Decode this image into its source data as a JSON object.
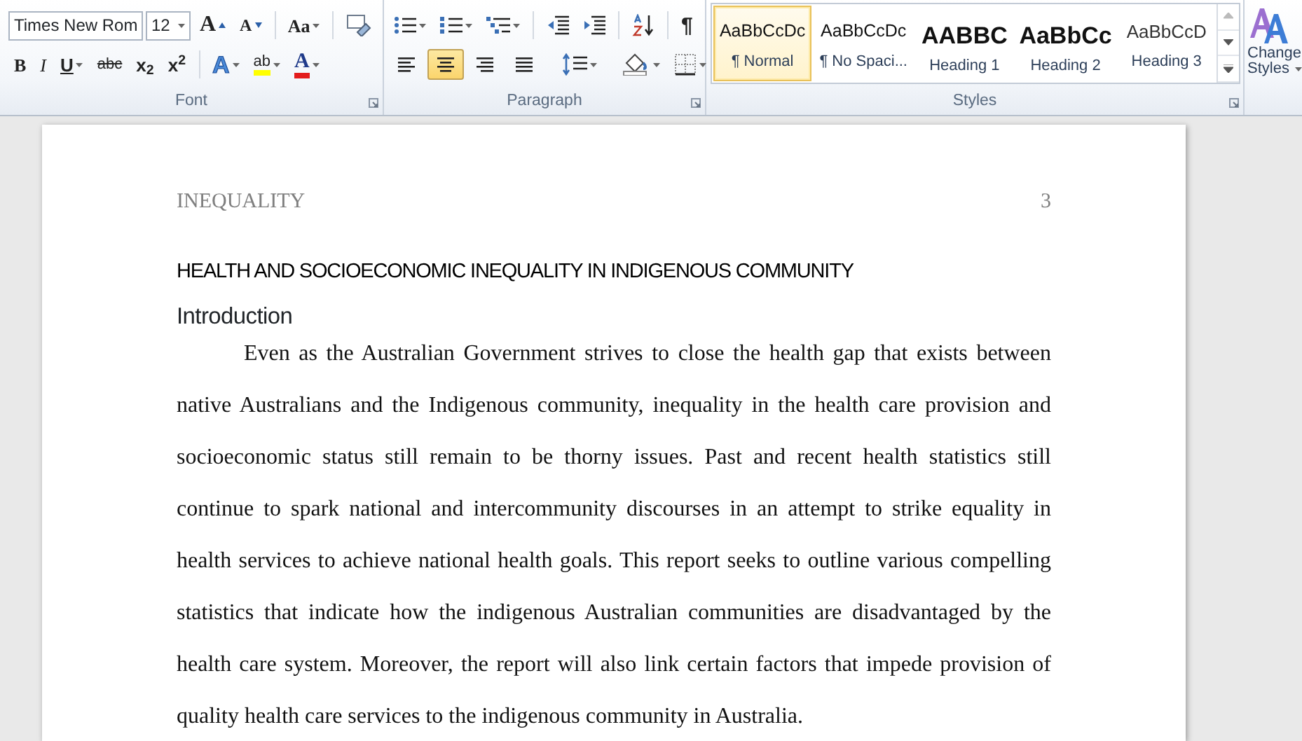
{
  "ribbon": {
    "font_group": {
      "title": "Font",
      "font_name": "Times New Rom",
      "font_size": "12",
      "row1": [
        {
          "kind": "grow",
          "glyph": "A"
        },
        {
          "kind": "shrink",
          "glyph": "A"
        },
        {
          "kind": "case",
          "glyph": "Aa"
        },
        {
          "kind": "clear"
        }
      ],
      "row2": [
        {
          "kind": "bold",
          "glyph": "B"
        },
        {
          "kind": "italic",
          "glyph": "I"
        },
        {
          "kind": "underline",
          "glyph": "U"
        },
        {
          "kind": "strike",
          "glyph": "abc"
        },
        {
          "kind": "sub",
          "glyph": "x$_{2}$"
        },
        {
          "kind": "sup",
          "glyph": "x$^{2}$"
        },
        {
          "kind": "effects",
          "glyph": "A"
        },
        {
          "kind": "highlight",
          "glyph": "ab"
        },
        {
          "kind": "color",
          "glyph": "A"
        }
      ]
    },
    "paragraph_group": {
      "title": "Paragraph",
      "marks_glyph": "¶",
      "alignments": [
        {
          "kind": "left",
          "selected": false
        },
        {
          "kind": "center",
          "selected": true
        },
        {
          "kind": "right",
          "selected": false
        },
        {
          "kind": "justify",
          "selected": false
        }
      ]
    },
    "styles_group": {
      "title": "Styles",
      "items": [
        {
          "kind": "normal",
          "sample": "AaBbCcDc",
          "name": "¶ Normal",
          "selected": true
        },
        {
          "kind": "normal",
          "sample": "AaBbCcDc",
          "name": "¶ No Spaci...",
          "selected": false
        },
        {
          "kind": "h1",
          "sample": "AABBC",
          "name": "Heading 1",
          "selected": false
        },
        {
          "kind": "h2",
          "sample": "AaBbCc",
          "name": "Heading 2",
          "selected": false
        },
        {
          "kind": "h3",
          "sample": "AaBbCcD",
          "name": "Heading 3",
          "selected": false
        }
      ],
      "change_styles": [
        "Change",
        "Styles"
      ]
    }
  },
  "document": {
    "header": "INEQUALITY",
    "page_number": "3",
    "title": "HEALTH AND SOCIOECONOMIC INEQUALITY IN INDIGENOUS COMMUNITY",
    "heading": "Introduction",
    "paragraph": "Even as the Australian Government strives to close the health gap that exists between native Australians and the Indigenous community, inequality in the health care provision and socioeconomic status still remain to be thorny issues. Past and recent health statistics still continue to spark national and intercommunity discourses in an attempt to strike equality in health services to achieve national health goals. This report seeks to outline various compelling statistics that indicate how the indigenous Australian communities are disadvantaged by the health care system. Moreover, the report will also link certain factors that impede provision of quality health care services to the indigenous community in Australia."
  }
}
